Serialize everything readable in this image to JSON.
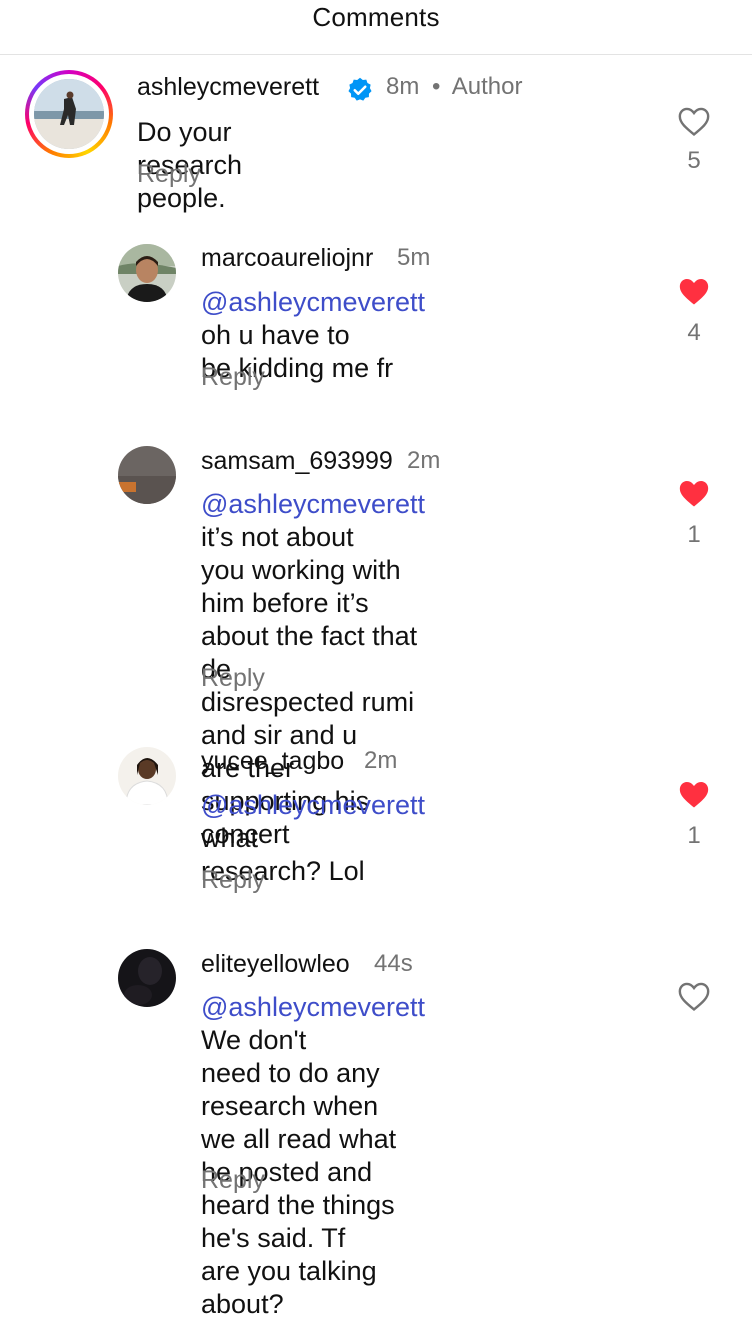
{
  "header": {
    "title": "Comments"
  },
  "comments": [
    {
      "username": "ashleycmeverett",
      "verified": true,
      "time": "8m",
      "separator": "•",
      "badge": "Author",
      "text": "Do your research people.",
      "reply_label": "Reply",
      "liked": false,
      "like_count": "5"
    },
    {
      "username": "marcoaureliojnr",
      "time": "5m",
      "mention": "@ashleycmeverett",
      "lines": [
        " oh u have to",
        "be kidding me fr"
      ],
      "reply_label": "Reply",
      "liked": true,
      "like_count": "4"
    },
    {
      "username": "samsam_693999",
      "time": "2m",
      "mention": "@ashleycmeverett",
      "lines": [
        " it’s not about",
        "you working with him before it’s",
        "about the fact that de",
        "disrespected rumi and sir and u",
        "are ther supporting his concert"
      ],
      "reply_label": "Reply",
      "liked": true,
      "like_count": "1"
    },
    {
      "username": "yucee_tagbo",
      "time": "2m",
      "mention": "@ashleycmeverett",
      "lines": [
        " what",
        "research? Lol"
      ],
      "reply_label": "Reply",
      "liked": true,
      "like_count": "1"
    },
    {
      "username": "eliteyellowleo",
      "time": "44s",
      "mention": "@ashleycmeverett",
      "lines": [
        " We don't",
        "need to do any research when",
        "we all read what he posted and",
        "heard the things he's said. Tf",
        "are you talking about?"
      ],
      "reply_label": "Reply",
      "liked": false,
      "like_count": ""
    }
  ],
  "colors": {
    "heart_liked": "#ff3040",
    "mention": "#3e4dc9",
    "verified": "#0095f6",
    "secondary_text": "#737373"
  },
  "icons": {
    "like_outline": "heart-outline-icon",
    "like_filled": "heart-filled-icon",
    "verified": "verified-badge-icon"
  }
}
